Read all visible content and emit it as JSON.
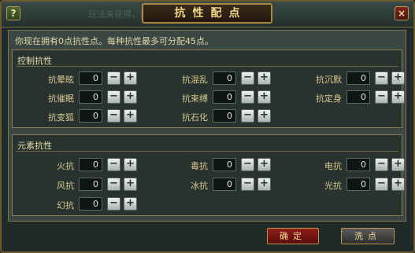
{
  "window": {
    "title": "抗性配点",
    "bg_text": "玩法来获得，比如副本、任务等，但是切勿",
    "help_label": "?",
    "close_label": "×"
  },
  "info_text": "你现在拥有0点抗性点。每种抗性最多可分配45点。",
  "control": {
    "title": "控制抗性",
    "items": [
      {
        "label": "抗晕眩",
        "value": "0"
      },
      {
        "label": "抗混乱",
        "value": "0"
      },
      {
        "label": "抗沉默",
        "value": "0"
      },
      {
        "label": "抗催眠",
        "value": "0"
      },
      {
        "label": "抗束缚",
        "value": "0"
      },
      {
        "label": "抗定身",
        "value": "0"
      },
      {
        "label": "抗变狐",
        "value": "0"
      },
      {
        "label": "抗石化",
        "value": "0"
      }
    ]
  },
  "element": {
    "title": "元素抗性",
    "items": [
      {
        "label": "火抗",
        "value": "0"
      },
      {
        "label": "毒抗",
        "value": "0"
      },
      {
        "label": "电抗",
        "value": "0"
      },
      {
        "label": "风抗",
        "value": "0"
      },
      {
        "label": "冰抗",
        "value": "0"
      },
      {
        "label": "光抗",
        "value": "0"
      },
      {
        "label": "幻抗",
        "value": "0"
      }
    ]
  },
  "buttons": {
    "minus": "−",
    "plus": "+",
    "confirm": "确定",
    "reset": "洗点"
  }
}
